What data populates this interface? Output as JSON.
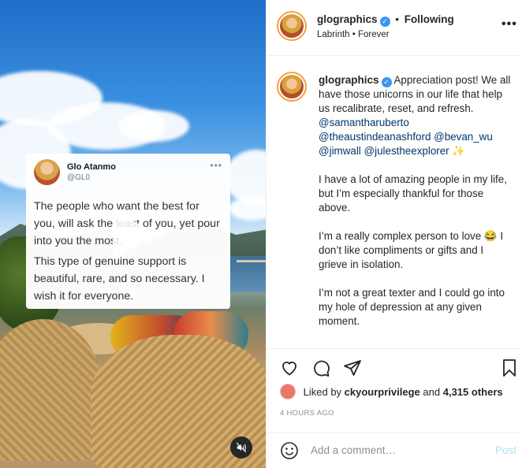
{
  "post": {
    "username": "glographics",
    "following_label": "Following",
    "music": "Labrinth • Forever"
  },
  "tweet": {
    "name": "Glo Atanmo",
    "handle": "@GL0",
    "paragraph1": "The people who want the best for you, will ask the least of you, yet pour into you the most.",
    "paragraph2": "This type of genuine support is beautiful, rare, and so necessary. I wish it for everyone."
  },
  "caption": {
    "username": "glographics",
    "intro": "Appreciation post! We all have those unicorns in our life that help us recalibrate, reset, and refresh.",
    "mentions": [
      "@samantharuberto",
      "@theaustindeanashford",
      "@bevan_wu",
      "@jimwall",
      "@julestheexplorer"
    ],
    "sparkle": "✨",
    "p2": "I have a lot of amazing people in my life, but I’m especially thankful for those above.",
    "p3_a": "I’m a really complex person to love",
    "p3_emoji": "😂",
    "p3_b": "I don’t like compliments or gifts and I grieve in isolation.",
    "p4": "I’m not a great texter and I could go into my hole of depression at any given moment."
  },
  "likes": {
    "prefix": "Liked by",
    "user": "ckyourprivilege",
    "middle": "and",
    "count": "4,315 others"
  },
  "timestamp": "4 HOURS AGO",
  "comment": {
    "placeholder": "Add a comment…",
    "post_label": "Post"
  },
  "icons": {
    "verified": "verified-badge-icon",
    "more": "more-options-icon",
    "like": "heart-icon",
    "comment": "comment-bubble-icon",
    "share": "paper-plane-icon",
    "save": "bookmark-icon",
    "emoji": "emoji-smile-icon",
    "mute": "speaker-muted-icon",
    "play": "play-icon"
  },
  "colors": {
    "link": "#00376b",
    "verified": "#3897f0",
    "post_disabled": "#b2dffc",
    "muted_text": "#8e8e8e"
  }
}
